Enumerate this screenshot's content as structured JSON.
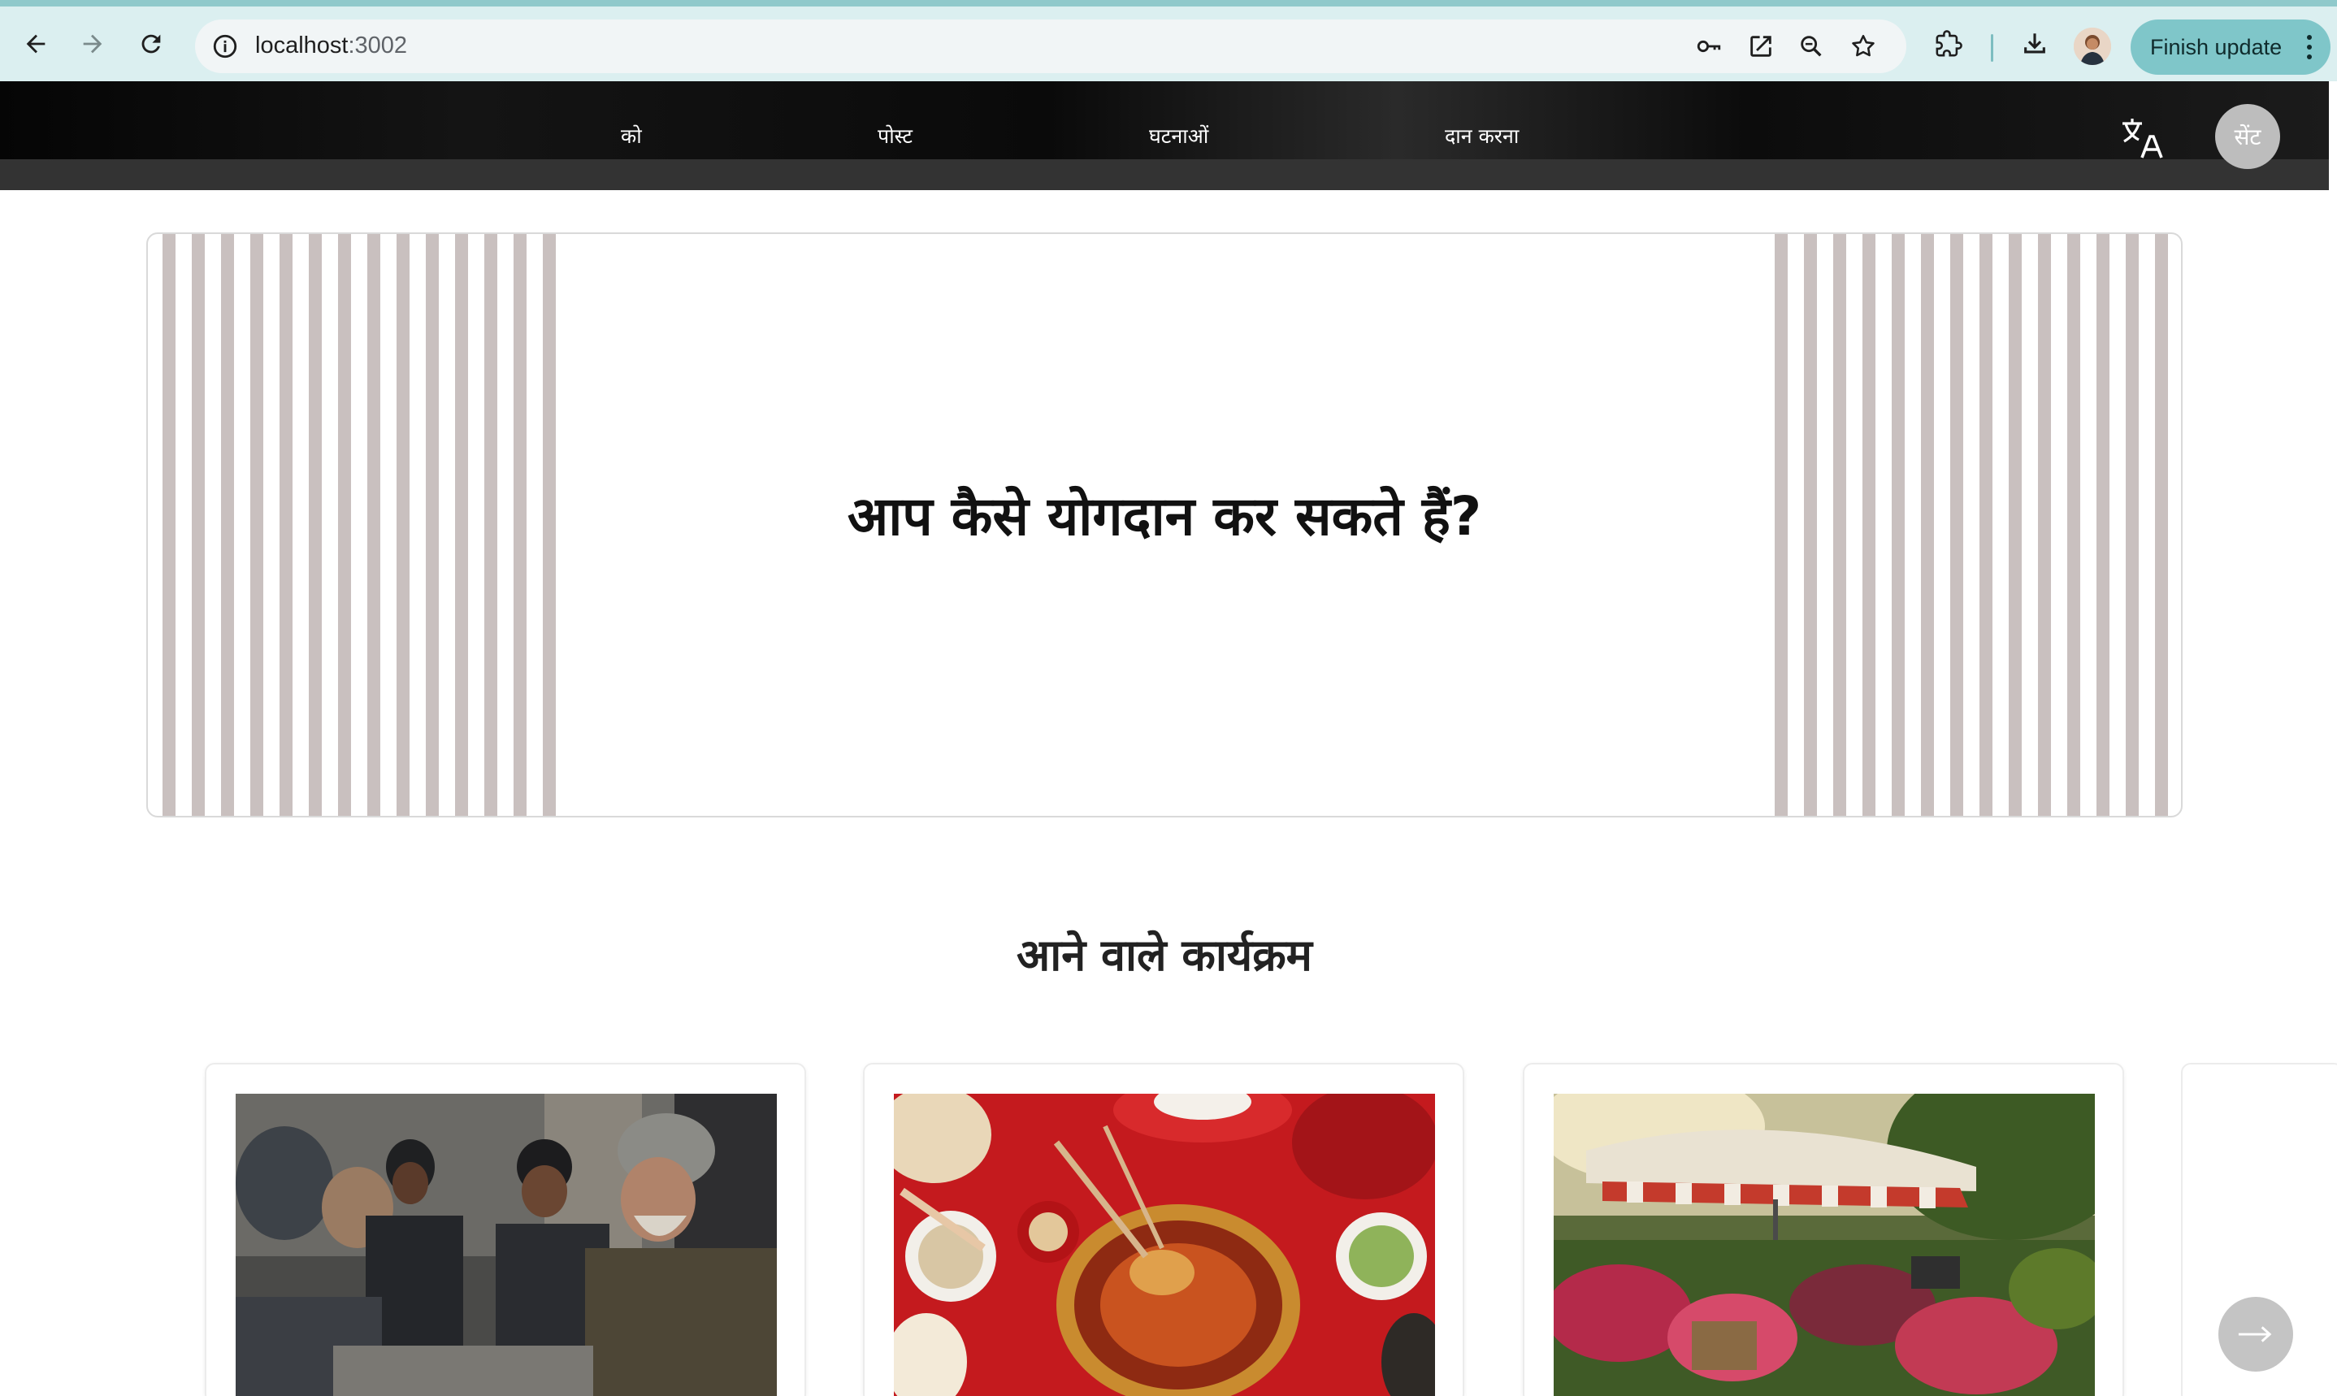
{
  "browser": {
    "url_host": "localhost",
    "url_port": ":3002",
    "finish_update_label": "Finish update"
  },
  "nav": {
    "items": [
      {
        "label": "को"
      },
      {
        "label": "पोस्ट"
      },
      {
        "label": "घटनाओं"
      },
      {
        "label": "दान करना"
      }
    ],
    "avatar_label": "सेंट"
  },
  "hero": {
    "title": "आप कैसे योगदान कर सकते हैं?"
  },
  "events": {
    "title": "आने वाले कार्यक्रम",
    "cards": [
      {
        "image": "community-meal-photo"
      },
      {
        "image": "festive-food-table-photo"
      },
      {
        "image": "flower-market-photo"
      }
    ]
  },
  "colors": {
    "chrome_bg": "#dbeff0",
    "accent_teal": "#7fc6c9",
    "nav_bg": "#0a0a0a",
    "stripe": "#c9c0bf"
  }
}
